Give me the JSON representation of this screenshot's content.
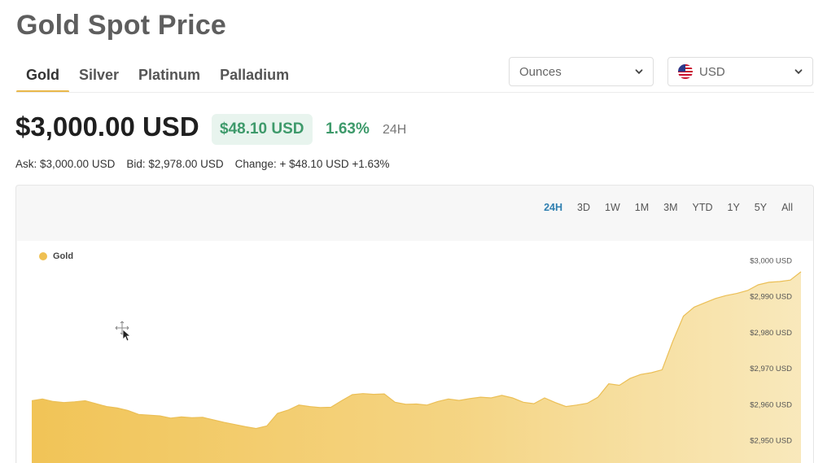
{
  "page": {
    "title": "Gold Spot Price"
  },
  "metal_tabs": [
    {
      "label": "Gold",
      "active": true
    },
    {
      "label": "Silver",
      "active": false
    },
    {
      "label": "Platinum",
      "active": false
    },
    {
      "label": "Palladium",
      "active": false
    }
  ],
  "unit_select": {
    "value": "Ounces",
    "icon": "chevron-down-icon"
  },
  "currency_select": {
    "value": "USD",
    "icon": "us-flag-icon"
  },
  "price": {
    "main": "$3,000.00 USD",
    "change_amount": "$48.10 USD",
    "change_percent": "1.63%",
    "period": "24H"
  },
  "quote": {
    "ask": "Ask: $3,000.00 USD",
    "bid": "Bid: $2,978.00 USD",
    "change": "Change: + $48.10 USD +1.63%"
  },
  "range_buttons": [
    {
      "label": "24H",
      "active": true
    },
    {
      "label": "3D",
      "active": false
    },
    {
      "label": "1W",
      "active": false
    },
    {
      "label": "1M",
      "active": false
    },
    {
      "label": "3M",
      "active": false
    },
    {
      "label": "YTD",
      "active": false
    },
    {
      "label": "1Y",
      "active": false
    },
    {
      "label": "5Y",
      "active": false
    },
    {
      "label": "All",
      "active": false
    }
  ],
  "colors": {
    "accent": "#e9b84a",
    "positive": "#3e9a6b",
    "area_fill": "#f0c04e",
    "active_range": "#2f7fb0"
  },
  "chart_data": {
    "type": "area",
    "legend": [
      {
        "name": "Gold",
        "color": "#efc052"
      }
    ],
    "legend_position": "top-left",
    "y_axis_side": "right",
    "ylim": [
      2943.5,
      3002
    ],
    "y_ticks": [
      3000,
      2990,
      2980,
      2970,
      2960,
      2950
    ],
    "y_tick_labels": [
      "$3,000 USD",
      "$2,990 USD",
      "$2,980 USD",
      "$2,970 USD",
      "$2,960 USD",
      "$2,950 USD"
    ],
    "series": [
      {
        "name": "Gold",
        "values": [
          2961.0,
          2961.5,
          2960.8,
          2960.5,
          2960.7,
          2961.0,
          2960.2,
          2959.4,
          2959.0,
          2958.3,
          2957.2,
          2957.0,
          2956.8,
          2956.2,
          2956.5,
          2956.3,
          2956.4,
          2955.7,
          2955.0,
          2954.4,
          2953.8,
          2953.3,
          2954.0,
          2957.5,
          2958.4,
          2959.8,
          2959.4,
          2959.1,
          2959.2,
          2961.0,
          2962.7,
          2963.0,
          2962.8,
          2962.9,
          2960.6,
          2960.0,
          2960.1,
          2959.8,
          2960.8,
          2961.5,
          2961.1,
          2961.6,
          2962.0,
          2961.8,
          2962.5,
          2961.8,
          2960.6,
          2960.2,
          2961.8,
          2960.5,
          2959.4,
          2959.8,
          2960.3,
          2962.0,
          2965.7,
          2965.3,
          2967.2,
          2968.3,
          2968.8,
          2969.6,
          2977.5,
          2984.5,
          2987.0,
          2988.2,
          2989.4,
          2990.2,
          2990.8,
          2991.6,
          2993.2,
          2993.9,
          2994.1,
          2994.5,
          2996.8
        ]
      }
    ],
    "grid": false
  }
}
